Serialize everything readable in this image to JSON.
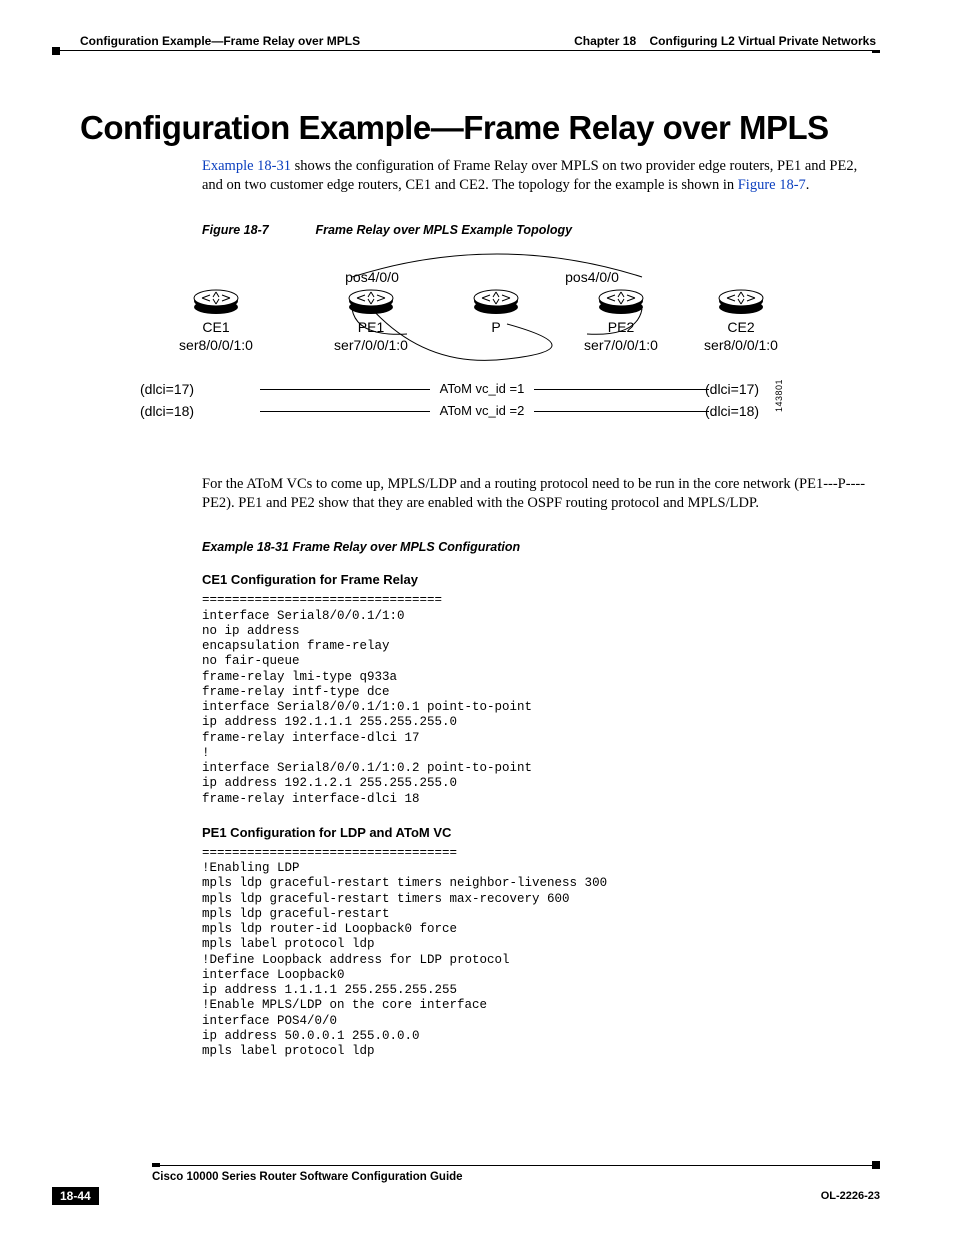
{
  "header": {
    "left": "Configuration Example—Frame Relay over MPLS",
    "right_chapter": "Chapter 18",
    "right_title": "Configuring L2 Virtual Private Networks"
  },
  "title": "Configuration Example—Frame Relay over MPLS",
  "intro_parts": {
    "link1": "Example 18-31",
    "mid": " shows the configuration of Frame Relay over MPLS on two provider edge routers, PE1 and PE2, and on two customer edge routers, CE1 and CE2. The topology for the example is shown in ",
    "link2": "Figure 18-7",
    "tail": "."
  },
  "figure": {
    "num": "Figure 18-7",
    "title": "Frame Relay over MPLS Example Topology",
    "labels": {
      "pos_a": "pos4/0/0",
      "pos_b": "pos4/0/0",
      "ce1": "CE1",
      "pe1": "PE1",
      "p": "P",
      "pe2": "PE2",
      "ce2": "CE2",
      "ce1_if": "ser8/0/0/1:0",
      "pe1_if": "ser7/0/0/1:0",
      "pe2_if": "ser7/0/0/1:0",
      "ce2_if": "ser8/0/0/1:0",
      "dlci17_l": "(dlci=17)",
      "dlci18_l": "(dlci=18)",
      "atom1": "AToM vc_id =1",
      "atom2": "AToM vc_id =2",
      "dlci17_r": "(dlci=17)",
      "dlci18_r": "(dlci=18)",
      "sideid": "143801"
    }
  },
  "para2": "For the AToM VCs to come up, MPLS/LDP and a routing protocol need to be run in the core network (PE1---P----PE2). PE1 and PE2 show that they are enabled with the OSPF routing protocol and MPLS/LDP.",
  "example_caption": "Example 18-31 Frame Relay over MPLS Configuration",
  "sub1": "CE1 Configuration for Frame Relay",
  "code1": "================================\ninterface Serial8/0/0.1/1:0\nno ip address\nencapsulation frame-relay\nno fair-queue\nframe-relay lmi-type q933a\nframe-relay intf-type dce\ninterface Serial8/0/0.1/1:0.1 point-to-point\nip address 192.1.1.1 255.255.255.0\nframe-relay interface-dlci 17\n!\ninterface Serial8/0/0.1/1:0.2 point-to-point\nip address 192.1.2.1 255.255.255.0\nframe-relay interface-dlci 18",
  "sub2": "PE1 Configuration for LDP and AToM VC",
  "code2": "==================================\n!Enabling LDP\nmpls ldp graceful-restart timers neighbor-liveness 300\nmpls ldp graceful-restart timers max-recovery 600\nmpls ldp graceful-restart\nmpls ldp router-id Loopback0 force\nmpls label protocol ldp\n!Define Loopback address for LDP protocol\ninterface Loopback0\nip address 1.1.1.1 255.255.255.255\n!Enable MPLS/LDP on the core interface\ninterface POS4/0/0\nip address 50.0.0.1 255.0.0.0\nmpls label protocol ldp",
  "footer": {
    "book": "Cisco 10000 Series Router Software Configuration Guide",
    "pagenum": "18-44",
    "docnum": "OL-2226-23"
  }
}
